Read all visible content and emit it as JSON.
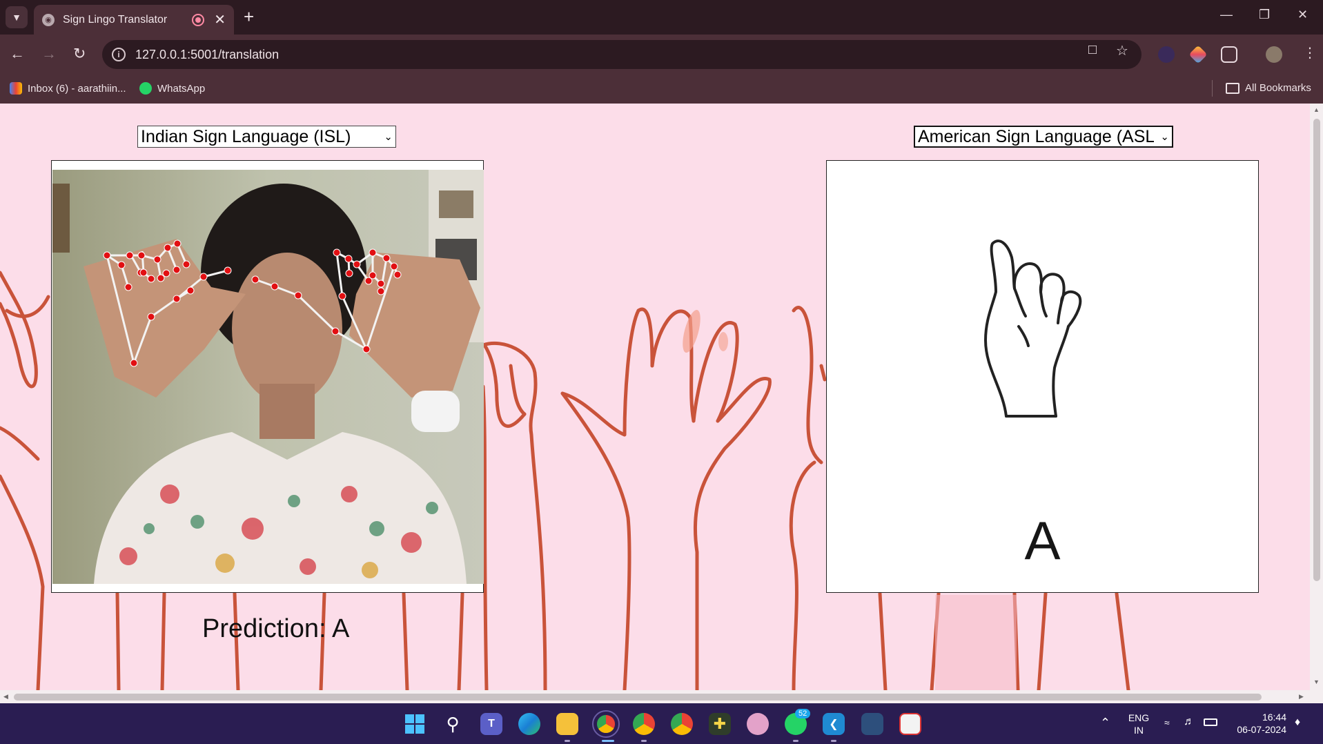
{
  "browser": {
    "tab_title": "Sign Lingo Translator",
    "url": "127.0.0.1:5001/translation",
    "bookmarks": [
      "Inbox (6) - aarathiin...",
      "WhatsApp"
    ],
    "all_bookmarks_label": "All Bookmarks"
  },
  "page": {
    "source_language": "Indian Sign Language (ISL)",
    "target_language": "American Sign Language (ASL)",
    "prediction_label": "Prediction: A",
    "output_letter": "A",
    "background_color": "#fcdde9",
    "art_color": "#c9533a"
  },
  "taskbar": {
    "lang_line1": "ENG",
    "lang_line2": "IN",
    "time": "16:44",
    "date": "06-07-2024",
    "whatsapp_badge": "52"
  }
}
